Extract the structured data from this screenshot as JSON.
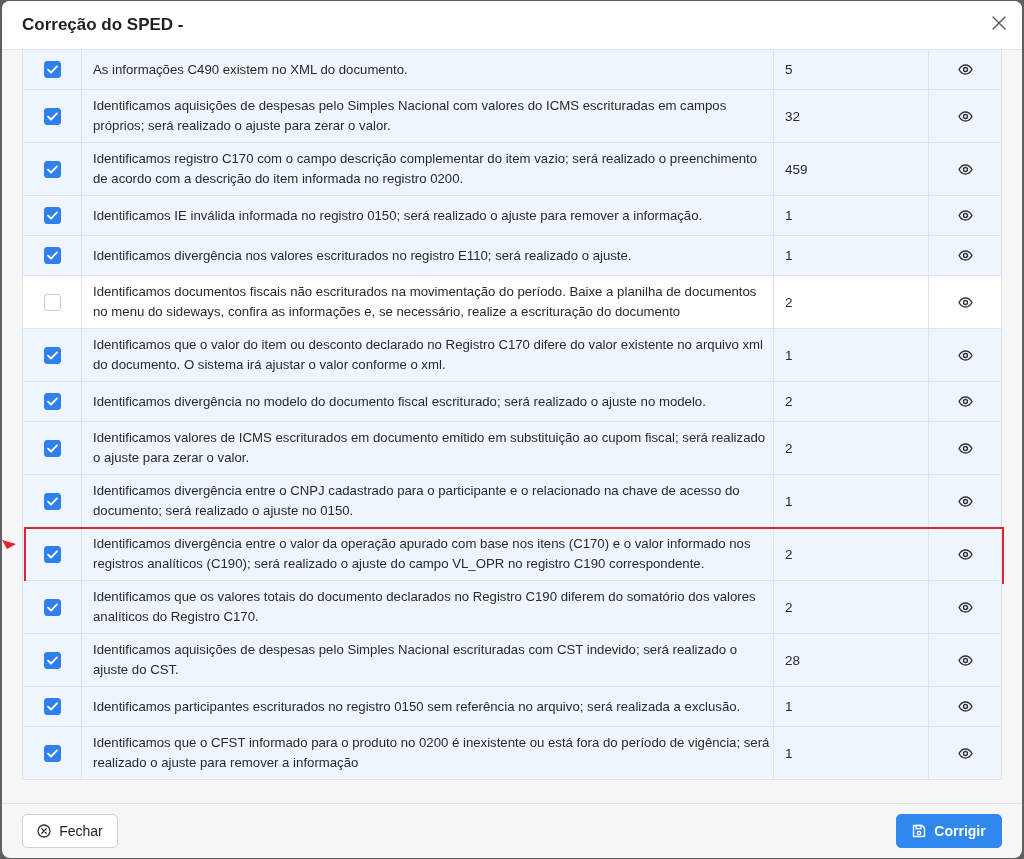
{
  "dialog": {
    "title": "Correção do SPED -"
  },
  "rows": [
    {
      "checked": true,
      "highlighted": false,
      "description": "As informações C490 existem no XML do documento.",
      "count": "5"
    },
    {
      "checked": true,
      "highlighted": false,
      "description": "Identificamos aquisições de despesas pelo Simples Nacional com valores do ICMS escrituradas em campos próprios; será realizado o ajuste para zerar o valor.",
      "count": "32"
    },
    {
      "checked": true,
      "highlighted": false,
      "description": "Identificamos registro C170 com o campo descrição complementar do item vazio; será realizado o preenchimento de acordo com a descrição do item informada no registro 0200.",
      "count": "459"
    },
    {
      "checked": true,
      "highlighted": false,
      "description": "Identificamos IE inválida informada no registro 0150; será realizado o ajuste para remover a informação.",
      "count": "1"
    },
    {
      "checked": true,
      "highlighted": false,
      "description": "Identificamos divergência nos valores escriturados no registro E110; será realizado o ajuste.",
      "count": "1"
    },
    {
      "checked": false,
      "highlighted": false,
      "description": "Identificamos documentos fiscais não escriturados na movimentação do período. Baixe a planilha de documentos no menu do sideways, confira as informações e, se necessário, realize a escrituração do documento",
      "count": "2"
    },
    {
      "checked": true,
      "highlighted": false,
      "description": "Identificamos que o valor do item ou desconto declarado no Registro C170 difere do valor existente no arquivo xml do documento. O sistema irá ajustar o valor conforme o xml.",
      "count": "1"
    },
    {
      "checked": true,
      "highlighted": false,
      "description": "Identificamos divergência no modelo do documento fiscal escriturado; será realizado o ajuste no modelo.",
      "count": "2"
    },
    {
      "checked": true,
      "highlighted": false,
      "description": "Identificamos valores de ICMS escriturados em documento emitido em substituição ao cupom fiscal; será realizado o ajuste para zerar o valor.",
      "count": "2"
    },
    {
      "checked": true,
      "highlighted": false,
      "description": "Identificamos divergência entre o CNPJ cadastrado para o participante e o relacionado na chave de acesso do documento; será realizado o ajuste no 0150.",
      "count": "1"
    },
    {
      "checked": true,
      "highlighted": true,
      "description": "Identificamos divergência entre o valor da operação apurado com base nos itens (C170) e o valor informado nos registros analíticos (C190); será realizado o ajuste do campo VL_OPR no registro C190 correspondente.",
      "count": "2"
    },
    {
      "checked": true,
      "highlighted": false,
      "description": "Identificamos que os valores totais do documento declarados no Registro C190 diferem do somatório dos valores analíticos do Registro C170.",
      "count": "2"
    },
    {
      "checked": true,
      "highlighted": false,
      "description": "Identificamos aquisições de despesas pelo Simples Nacional escrituradas com CST indevido; será realizado o ajuste do CST.",
      "count": "28"
    },
    {
      "checked": true,
      "highlighted": false,
      "description": "Identificamos participantes escriturados no registro 0150 sem referência no arquivo; será realizada a exclusão.",
      "count": "1"
    },
    {
      "checked": true,
      "highlighted": false,
      "description": "Identificamos que o CFST informado para o produto no 0200 é inexistente ou está fora do período de vigência; será realizado o ajuste para remover a informação",
      "count": "1"
    }
  ],
  "footer": {
    "buttons": [
      {
        "label": "Fechar",
        "kind": "secondary"
      },
      {
        "label": "Corrigir",
        "kind": "primary"
      }
    ]
  }
}
